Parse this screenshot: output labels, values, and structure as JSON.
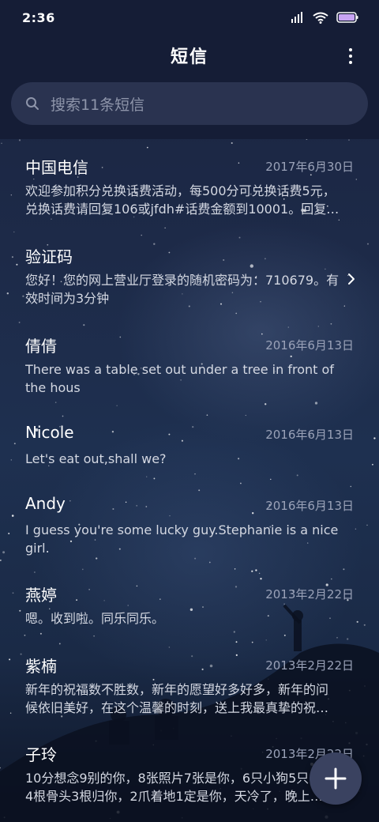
{
  "status_bar": {
    "time": "2:36"
  },
  "app_bar": {
    "title": "短信"
  },
  "search": {
    "placeholder": "搜索11条短信"
  },
  "messages": [
    {
      "name": "中国电信",
      "date": "2017年6月30日",
      "preview": [
        "欢迎参加积分兑换话费活动，每500分可兑换话费5元，",
        "兑换话费请回复106或jfdh#话费金额到10001。回复…"
      ]
    },
    {
      "name": "验证码",
      "date": "",
      "preview": [
        "您好！您的网上营业厅登录的随机密码为：710679。有",
        "效时间为3分钟"
      ]
    },
    {
      "name": "倩倩",
      "date": "2016年6月13日",
      "preview": [
        "There was a table set out under a tree in front of",
        "the hous"
      ]
    },
    {
      "name": "Nicole",
      "date": "2016年6月13日",
      "preview": [
        "Let's eat out,shall we?"
      ]
    },
    {
      "name": "Andy",
      "date": "2016年6月13日",
      "preview": [
        "I guess you're some lucky guy.Stephanie is a nice",
        "girl."
      ]
    },
    {
      "name": "燕婷",
      "date": "2013年2月22日",
      "preview": [
        "嗯。收到啦。同乐同乐。"
      ]
    },
    {
      "name": "紫楠",
      "date": "2013年2月22日",
      "preview": [
        "新年的祝福数不胜数，新年的愿望好多好多，新年的问",
        "候依旧美好，在这个温馨的时刻，送上我最真挚的祝…"
      ]
    },
    {
      "name": "子玲",
      "date": "2013年2月22日",
      "preview": [
        "10分想念9别的你，8张照片7张是你，6只小狗5只…",
        "4根骨头3根归你，2爪着地1定是你，天冷了，晚上…"
      ]
    }
  ],
  "icons": {
    "signal": "signal-icon",
    "wifi": "wifi-icon",
    "battery": "battery-icon",
    "menu": "more-vertical-icon",
    "search": "search-icon",
    "chevron": "chevron-right-icon",
    "fab": "plus-icon"
  }
}
